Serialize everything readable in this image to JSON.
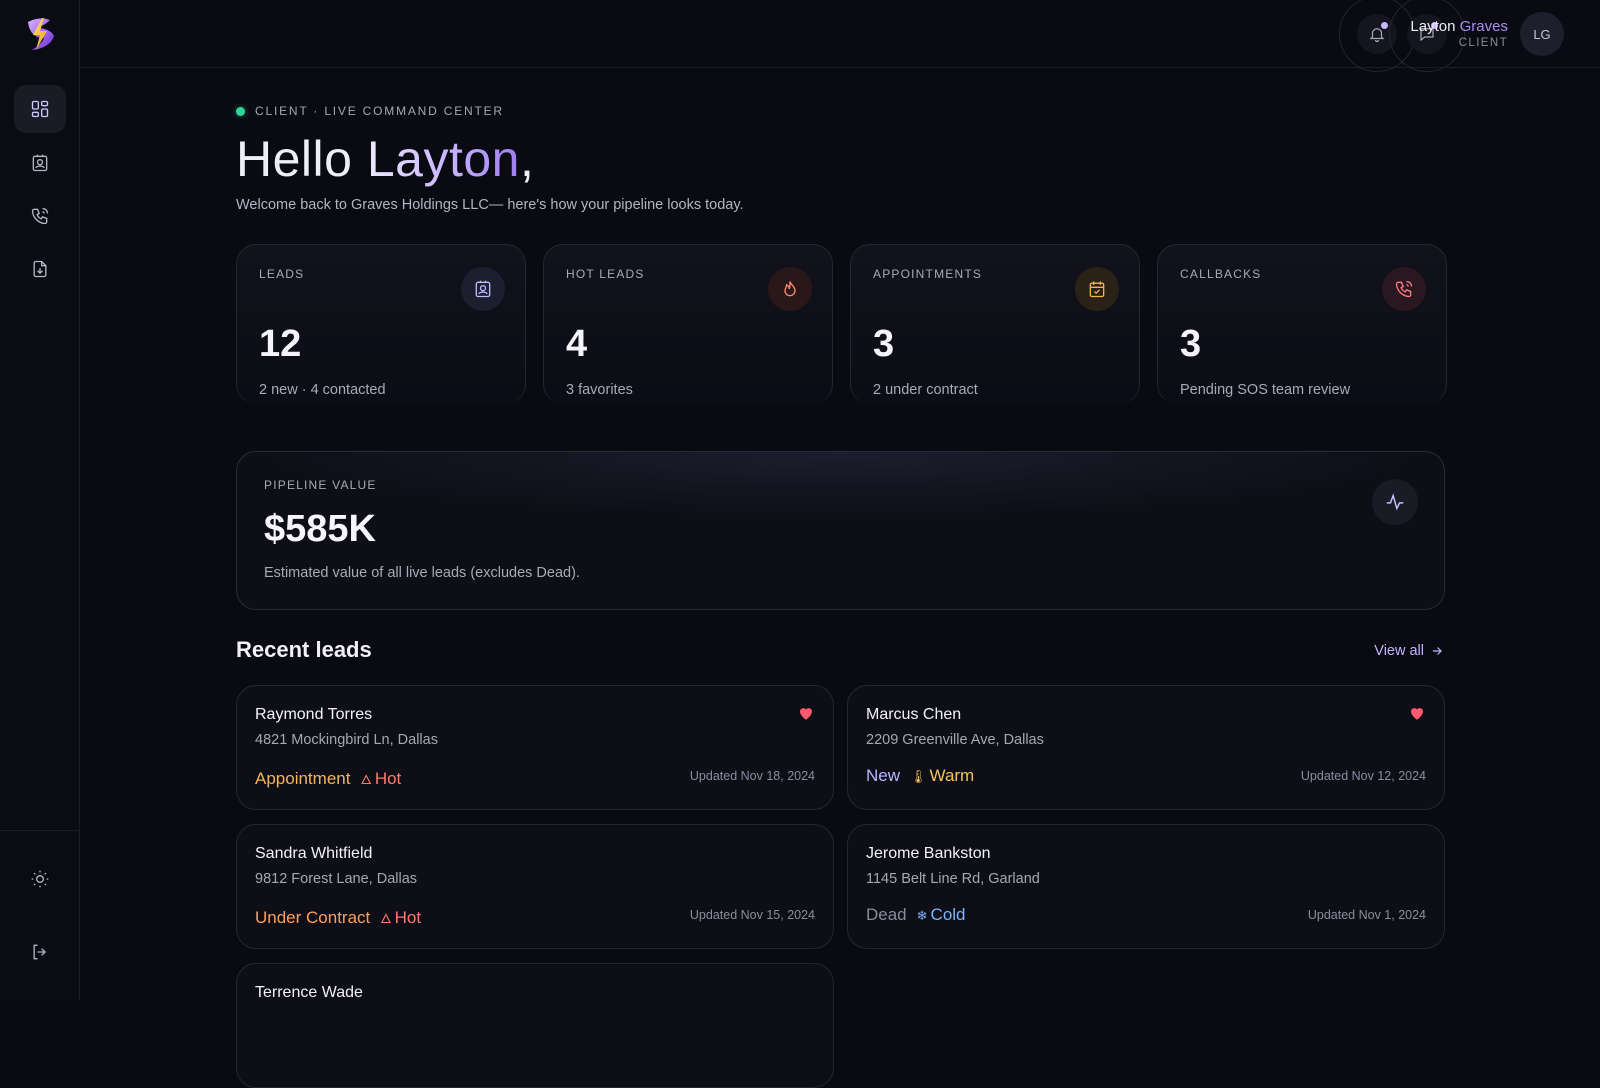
{
  "user": {
    "first_name": "Layton",
    "last_name": "Graves",
    "role": "CLIENT",
    "initials": "LG"
  },
  "header": {
    "eyebrow": "CLIENT · LIVE COMMAND CENTER",
    "greeting": "Hello",
    "greeting_name": "Layton",
    "greeting_punct": ",",
    "welcome": "Welcome back to Graves Holdings LLC— here's how your pipeline looks today."
  },
  "stats": [
    {
      "label": "LEADS",
      "value": "12",
      "sub": "2 new · 4 contacted",
      "icon": "contact-icon",
      "icon_color": "#b9b9ff",
      "icon_bg": "#1e1e2e"
    },
    {
      "label": "HOT LEADS",
      "value": "4",
      "sub": "3 favorites",
      "icon": "flame-icon",
      "icon_color": "#ff8a6b",
      "icon_bg": "#2a1719"
    },
    {
      "label": "APPOINTMENTS",
      "value": "3",
      "sub": "2 under contract",
      "icon": "calendar-icon",
      "icon_color": "#f3b34a",
      "icon_bg": "#2a2117"
    },
    {
      "label": "CALLBACKS",
      "value": "3",
      "sub": "Pending SOS team review",
      "icon": "phone-icon",
      "icon_color": "#ff7b86",
      "icon_bg": "#2a1720"
    }
  ],
  "pipeline": {
    "label": "PIPELINE VALUE",
    "value": "$585K",
    "sub": "Estimated value of all live leads (excludes Dead)."
  },
  "recent": {
    "title": "Recent leads",
    "view_all": "View all"
  },
  "leads": [
    {
      "name": "Raymond Torres",
      "address": "4821 Mockingbird Ln, Dallas",
      "status": "Appointment",
      "status_color": "#f4b45c",
      "temp": "Hot",
      "temp_icon": "flame-icon",
      "temp_color": "#ff7a6a",
      "updated": "Updated Nov 18, 2024",
      "favorite": true
    },
    {
      "name": "Marcus Chen",
      "address": "2209 Greenville Ave, Dallas",
      "status": "New",
      "status_color": "#b7b6ff",
      "temp": "Warm",
      "temp_icon": "thermometer-icon",
      "temp_color": "#f4c25c",
      "updated": "Updated Nov 12, 2024",
      "favorite": true
    },
    {
      "name": "Sandra Whitfield",
      "address": "9812 Forest Lane, Dallas",
      "status": "Under Contract",
      "status_color": "#ff9f5a",
      "temp": "Hot",
      "temp_icon": "flame-icon",
      "temp_color": "#ff7a6a",
      "updated": "Updated Nov 15, 2024",
      "favorite": false
    },
    {
      "name": "Jerome Bankston",
      "address": "1145 Belt Line Rd, Garland",
      "status": "Dead",
      "status_color": "#8a8a9c",
      "temp": "Cold",
      "temp_icon": "snowflake-icon",
      "temp_color": "#7fb2ff",
      "updated": "Updated Nov 1, 2024",
      "favorite": false
    },
    {
      "name": "Terrence Wade"
    }
  ],
  "colors": {
    "favorite": "#ff5a6e",
    "accent": "#a98cf2",
    "live": "#34d399"
  }
}
